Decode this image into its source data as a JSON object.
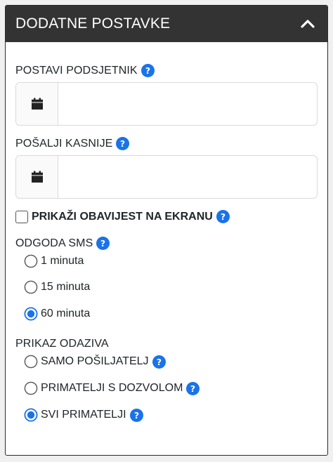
{
  "header": {
    "title": "DODATNE POSTAVKE",
    "toggle_icon": "chevron-up-icon"
  },
  "reminder": {
    "label": "POSTAVI PODSJETNIK",
    "value": "",
    "icon": "calendar-icon"
  },
  "send_later": {
    "label": "POŠALJI KASNIJE",
    "value": "",
    "icon": "calendar-icon"
  },
  "screen_notice": {
    "label": "PRIKAŽI OBAVIJEST NA EKRANU",
    "checked": false
  },
  "sms_delay": {
    "label": "ODGODA SMS",
    "options": [
      "1 minuta",
      "15 minuta",
      "60 minuta"
    ],
    "selected": "60 minuta"
  },
  "responses": {
    "label": "PRIKAZ ODAZIVA",
    "options": [
      "SAMO POŠILJATELJ",
      "PRIMATELJI S DOZVOLOM",
      "SVI PRIMATELJI"
    ],
    "selected": "SVI PRIMATELJI"
  },
  "colors": {
    "header_bg": "#333333",
    "accent": "#1a73e8",
    "border": "#dadada"
  }
}
